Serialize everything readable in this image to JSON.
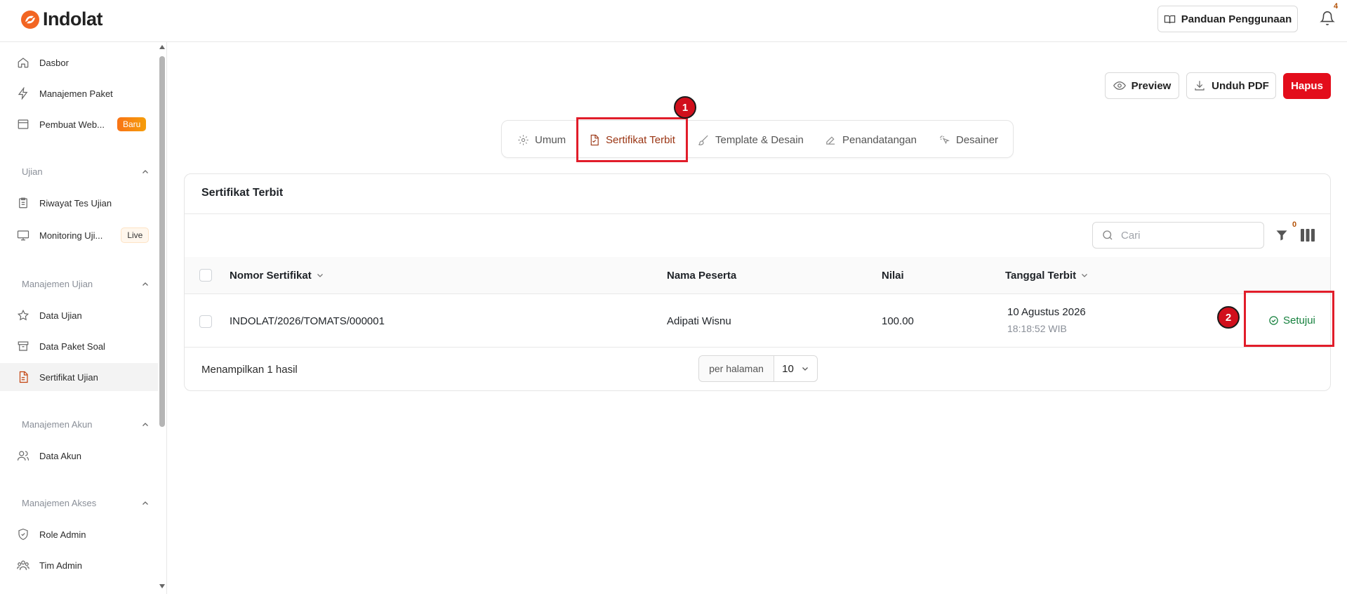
{
  "header": {
    "logo_text": "Indolat",
    "guide_button": "Panduan Penggunaan",
    "notification_count": "4"
  },
  "sidebar": {
    "items": [
      {
        "label": "Dasbor",
        "icon": "home-icon"
      },
      {
        "label": "Manajemen Paket",
        "icon": "lightning-icon"
      },
      {
        "label": "Pembuat Web...",
        "icon": "browser-icon",
        "badge": "Baru"
      },
      {
        "label": "Riwayat Tes Ujian",
        "icon": "clipboard-icon"
      },
      {
        "label": "Monitoring Uji...",
        "icon": "monitor-icon",
        "badge": "Live"
      },
      {
        "label": "Data Ujian",
        "icon": "star-icon"
      },
      {
        "label": "Data Paket Soal",
        "icon": "archive-icon"
      },
      {
        "label": "Sertifikat Ujian",
        "icon": "document-icon",
        "active": true
      },
      {
        "label": "Data Akun",
        "icon": "users-icon"
      },
      {
        "label": "Role Admin",
        "icon": "shield-icon"
      },
      {
        "label": "Tim Admin",
        "icon": "team-icon"
      }
    ],
    "sections": [
      "Ujian",
      "Manajemen Ujian",
      "Manajemen Akun",
      "Manajemen Akses"
    ]
  },
  "actions": {
    "preview": "Preview",
    "download_pdf": "Unduh PDF",
    "delete": "Hapus"
  },
  "tabs": [
    "Umum",
    "Sertifikat Terbit",
    "Template & Desain",
    "Penandatangan",
    "Desainer"
  ],
  "annotations": [
    "1",
    "2"
  ],
  "card": {
    "title": "Sertifikat Terbit",
    "search_placeholder": "Cari",
    "filter_count": "0",
    "columns": [
      "Nomor Sertifikat",
      "Nama Peserta",
      "Nilai",
      "Tanggal Terbit"
    ],
    "rows": [
      {
        "certificate_number": "INDOLAT/2026/TOMATS/000001",
        "participant": "Adipati Wisnu",
        "score": "100.00",
        "date": "10 Agustus 2026",
        "time": "18:18:52 WIB",
        "action": "Setujui"
      }
    ],
    "footer_text": "Menampilkan 1 hasil",
    "per_page_label": "per halaman",
    "per_page_value": "10"
  },
  "colors": {
    "brand_orange": "#f26522",
    "delete_red": "#e30d1b",
    "active_tab": "#9a3412",
    "approve_green": "#15803d",
    "annotation_red": "#e11d2a"
  }
}
